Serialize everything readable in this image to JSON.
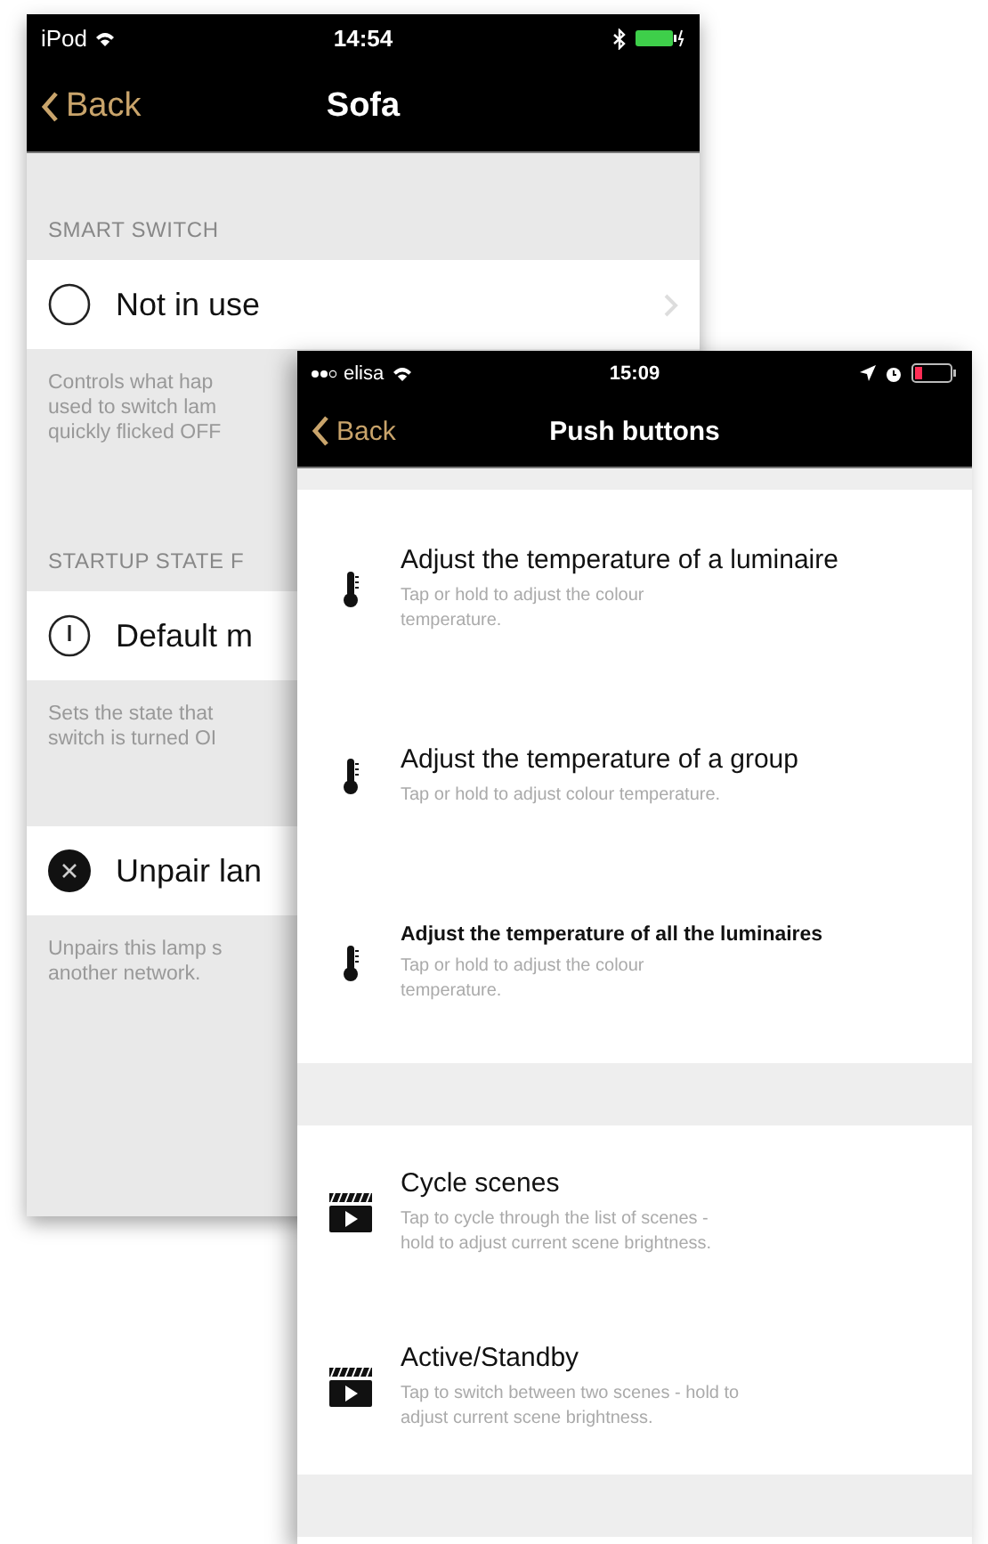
{
  "back_screen": {
    "status_bar": {
      "carrier": "iPod",
      "time": "14:54"
    },
    "nav": {
      "back": "Back",
      "title": "Sofa"
    },
    "sections": [
      {
        "header": "SMART SWITCH",
        "row": {
          "kind": "empty",
          "label": "Not in use",
          "chevron": true
        },
        "description": [
          "Controls what hap",
          "used to switch lam",
          "quickly flicked OFF"
        ]
      },
      {
        "header": "STARTUP STATE F",
        "row": {
          "kind": "power",
          "label": "Default m",
          "chevron": false
        },
        "description": [
          "Sets the state that",
          "switch is turned OI"
        ]
      },
      {
        "row": {
          "kind": "remove",
          "label": "Unpair lan",
          "chevron": false
        },
        "description": [
          "Unpairs this lamp s",
          "another network."
        ]
      }
    ]
  },
  "front_screen": {
    "status_bar": {
      "carrier": "elisa",
      "time": "15:09"
    },
    "nav": {
      "back": "Back",
      "title": "Push buttons"
    },
    "groups": [
      {
        "items": [
          {
            "kind": "thermometer",
            "title": "Adjust the temperature of a luminaire",
            "compact": false,
            "subtitle_lines": [
              "Tap or hold to adjust the colour",
              "temperature."
            ]
          },
          {
            "kind": "thermometer",
            "title": "Adjust the temperature of a group",
            "compact": false,
            "subtitle_lines": [
              "Tap or hold to adjust colour temperature."
            ]
          },
          {
            "kind": "thermometer",
            "title": "Adjust the temperature of all the luminaires",
            "compact": true,
            "subtitle_lines": [
              "Tap or hold to adjust the colour",
              "temperature."
            ]
          }
        ]
      },
      {
        "items": [
          {
            "kind": "clapper",
            "title": "Cycle scenes",
            "compact": false,
            "subtitle_lines": [
              "Tap to cycle through the list of scenes -",
              "hold to adjust current scene brightness."
            ]
          },
          {
            "kind": "clapper",
            "title": "Active/Standby",
            "compact": false,
            "subtitle_lines": [
              "Tap to switch between two scenes - hold to",
              "adjust current scene brightness."
            ]
          }
        ]
      }
    ]
  }
}
